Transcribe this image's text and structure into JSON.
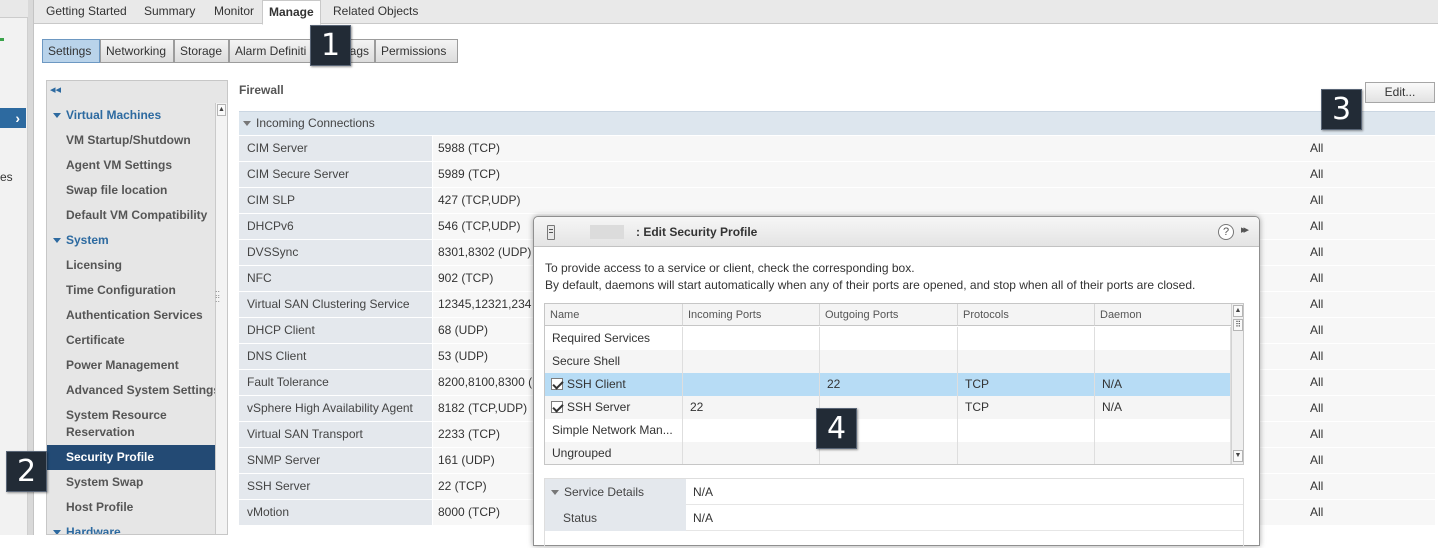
{
  "left_panel": {
    "partial_text": "es"
  },
  "top_tabs": [
    {
      "label": "Getting Started"
    },
    {
      "label": "Summary"
    },
    {
      "label": "Monitor"
    },
    {
      "label": "Manage"
    },
    {
      "label": "Related Objects"
    }
  ],
  "sub_tabs": [
    {
      "label": "Settings"
    },
    {
      "label": "Networking"
    },
    {
      "label": "Storage"
    },
    {
      "label": "Alarm Definiti"
    },
    {
      "label": "ags"
    },
    {
      "label": "Permissions"
    }
  ],
  "callouts": [
    "1",
    "2",
    "3",
    "4"
  ],
  "tree": {
    "collapse_glyph": "◂◂",
    "items": [
      {
        "label": "Virtual Machines"
      },
      {
        "label": "VM Startup/Shutdown"
      },
      {
        "label": "Agent VM Settings"
      },
      {
        "label": "Swap file location"
      },
      {
        "label": "Default VM Compatibility"
      },
      {
        "label": "System"
      },
      {
        "label": "Licensing"
      },
      {
        "label": "Time Configuration"
      },
      {
        "label": "Authentication Services"
      },
      {
        "label": "Certificate"
      },
      {
        "label": "Power Management"
      },
      {
        "label": "Advanced System Settings"
      },
      {
        "label": "System Resource Reservation"
      },
      {
        "label": "Security Profile"
      },
      {
        "label": "System Swap"
      },
      {
        "label": "Host Profile"
      },
      {
        "label": "Hardware"
      }
    ]
  },
  "firewall": {
    "title": "Firewall",
    "edit_label": "Edit...",
    "section_label": "Incoming Connections",
    "rows": [
      {
        "name": "CIM Server",
        "ports": "5988 (TCP)",
        "allowed": "All"
      },
      {
        "name": "CIM Secure Server",
        "ports": "5989 (TCP)",
        "allowed": "All"
      },
      {
        "name": "CIM SLP",
        "ports": "427 (TCP,UDP)",
        "allowed": "All"
      },
      {
        "name": "DHCPv6",
        "ports": "546 (TCP,UDP)",
        "allowed": "All"
      },
      {
        "name": "DVSSync",
        "ports": "8301,8302 (UDP)",
        "allowed": "All"
      },
      {
        "name": "NFC",
        "ports": "902 (TCP)",
        "allowed": "All"
      },
      {
        "name": "Virtual SAN Clustering Service",
        "ports": "12345,12321,234",
        "allowed": "All"
      },
      {
        "name": "DHCP Client",
        "ports": "68 (UDP)",
        "allowed": "All"
      },
      {
        "name": "DNS Client",
        "ports": "53 (UDP)",
        "allowed": "All"
      },
      {
        "name": "Fault Tolerance",
        "ports": "8200,8100,8300 (",
        "allowed": "All"
      },
      {
        "name": "vSphere High Availability Agent",
        "ports": "8182 (TCP,UDP)",
        "allowed": "All"
      },
      {
        "name": "Virtual SAN Transport",
        "ports": "2233 (TCP)",
        "allowed": "All"
      },
      {
        "name": "SNMP Server",
        "ports": "161 (UDP)",
        "allowed": "All"
      },
      {
        "name": "SSH Server",
        "ports": "22 (TCP)",
        "allowed": "All"
      },
      {
        "name": "vMotion",
        "ports": "8000 (TCP)",
        "allowed": "All"
      }
    ]
  },
  "dialog": {
    "title": ": Edit Security Profile",
    "help_glyph": "?",
    "more_glyph": "▸▸",
    "description_line1": "To provide access to a service or client, check the corresponding box.",
    "description_line2": "By default, daemons will start automatically when any of their ports are opened, and stop when all of their ports are closed.",
    "columns": [
      "Name",
      "Incoming Ports",
      "Outgoing Ports",
      "Protocols",
      "Daemon"
    ],
    "rows": [
      {
        "name": "Required Services",
        "incoming": "",
        "outgoing": "",
        "protocols": "",
        "daemon": ""
      },
      {
        "name": "Secure Shell",
        "incoming": "",
        "outgoing": "",
        "protocols": "",
        "daemon": ""
      },
      {
        "name": "SSH Client",
        "incoming": "",
        "outgoing": "22",
        "protocols": "TCP",
        "daemon": "N/A"
      },
      {
        "name": "SSH Server",
        "incoming": "22",
        "outgoing": "",
        "protocols": "TCP",
        "daemon": "N/A"
      },
      {
        "name": "Simple Network Man...",
        "incoming": "",
        "outgoing": "",
        "protocols": "",
        "daemon": ""
      },
      {
        "name": "Ungrouped",
        "incoming": "",
        "outgoing": "",
        "protocols": "",
        "daemon": ""
      }
    ],
    "details": {
      "section_label": "Service Details",
      "section_value": "N/A",
      "status_label": "Status",
      "status_value": "N/A"
    }
  }
}
